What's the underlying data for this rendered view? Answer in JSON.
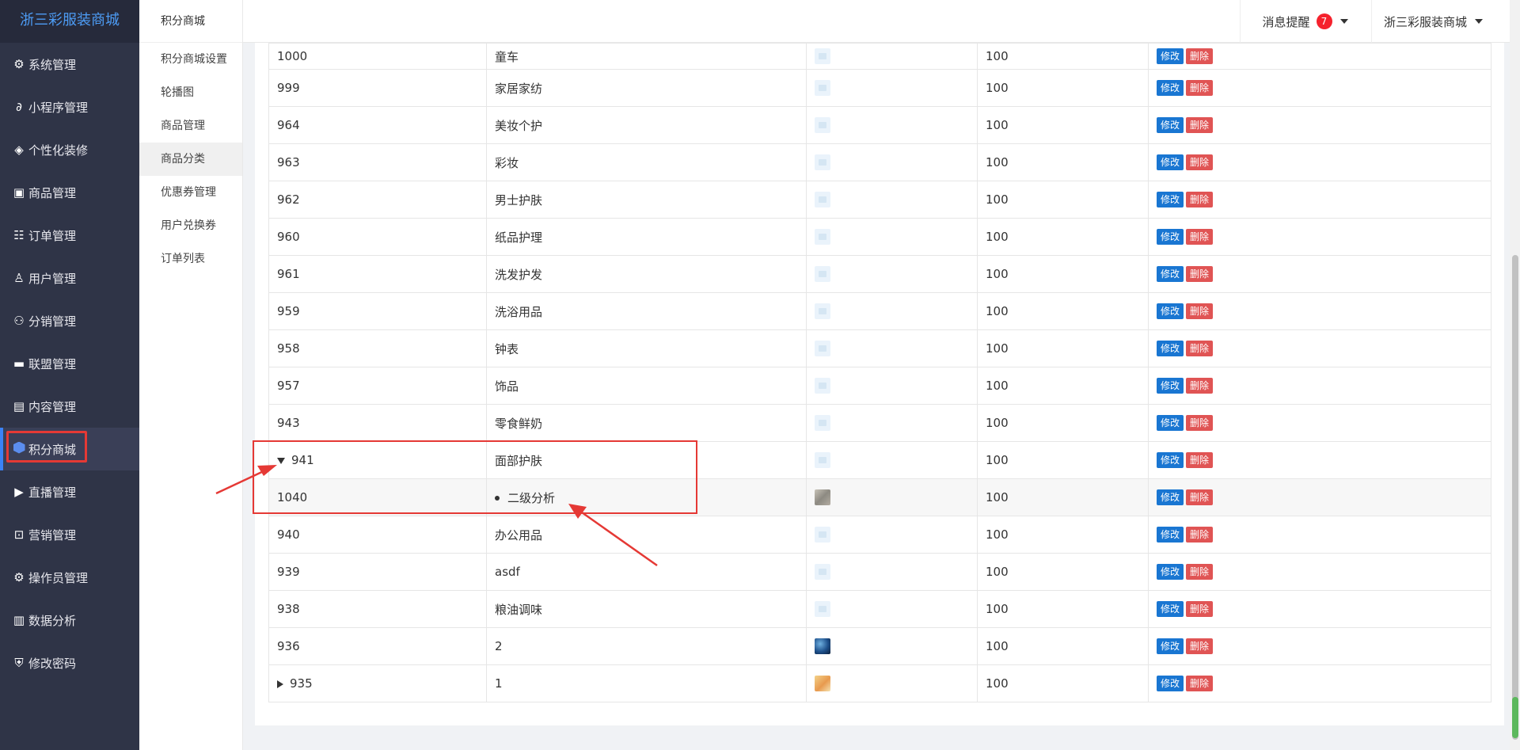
{
  "brand": "浙三彩服装商城",
  "sidebar": {
    "items": [
      {
        "label": "系统管理",
        "icon": "gear-icon",
        "glyph": "⚙"
      },
      {
        "label": "小程序管理",
        "icon": "link-icon",
        "glyph": "🔗"
      },
      {
        "label": "个性化装修",
        "icon": "diamond-icon",
        "glyph": "◈"
      },
      {
        "label": "商品管理",
        "icon": "bag-icon",
        "glyph": "▣"
      },
      {
        "label": "订单管理",
        "icon": "clipboard-icon",
        "glyph": "☷"
      },
      {
        "label": "用户管理",
        "icon": "user-icon",
        "glyph": "♙"
      },
      {
        "label": "分销管理",
        "icon": "network-icon",
        "glyph": "⚇"
      },
      {
        "label": "联盟管理",
        "icon": "store-icon",
        "glyph": "▬"
      },
      {
        "label": "内容管理",
        "icon": "content-icon",
        "glyph": "▤"
      },
      {
        "label": "积分商城",
        "icon": "cube-icon",
        "glyph": ""
      },
      {
        "label": "直播管理",
        "icon": "play-icon",
        "glyph": "▶"
      },
      {
        "label": "营销管理",
        "icon": "marketing-icon",
        "glyph": "⊡"
      },
      {
        "label": "操作员管理",
        "icon": "cog-icon",
        "glyph": "⚙"
      },
      {
        "label": "数据分析",
        "icon": "bar-chart-icon",
        "glyph": "▥"
      },
      {
        "label": "修改密码",
        "icon": "shield-icon",
        "glyph": "⛨"
      }
    ]
  },
  "subnav": {
    "title": "积分商城",
    "items": [
      "积分商城设置",
      "轮播图",
      "商品管理",
      "商品分类",
      "优惠券管理",
      "用户兑换券",
      "订单列表"
    ]
  },
  "header": {
    "messages_label": "消息提醒",
    "messages_count": "7",
    "shop_label": "浙三彩服装商城"
  },
  "table": {
    "edit_label": "修改",
    "delete_label": "删除",
    "rows": [
      {
        "id": "1000",
        "name": "童车",
        "sort": "100"
      },
      {
        "id": "999",
        "name": "家居家纺",
        "sort": "100"
      },
      {
        "id": "964",
        "name": "美妆个护",
        "sort": "100"
      },
      {
        "id": "963",
        "name": "彩妆",
        "sort": "100"
      },
      {
        "id": "962",
        "name": "男士护肤",
        "sort": "100"
      },
      {
        "id": "960",
        "name": "纸品护理",
        "sort": "100"
      },
      {
        "id": "961",
        "name": "洗发护发",
        "sort": "100"
      },
      {
        "id": "959",
        "name": "洗浴用品",
        "sort": "100"
      },
      {
        "id": "958",
        "name": "钟表",
        "sort": "100"
      },
      {
        "id": "957",
        "name": "饰品",
        "sort": "100"
      },
      {
        "id": "943",
        "name": "零食鲜奶",
        "sort": "100"
      },
      {
        "id": "941",
        "name": "面部护肤",
        "sort": "100"
      },
      {
        "id": "1040",
        "name": "二级分析",
        "sort": "100"
      },
      {
        "id": "940",
        "name": "办公用品",
        "sort": "100"
      },
      {
        "id": "939",
        "name": "asdf",
        "sort": "100"
      },
      {
        "id": "938",
        "name": "粮油调味",
        "sort": "100"
      },
      {
        "id": "936",
        "name": "2",
        "sort": "100"
      },
      {
        "id": "935",
        "name": "1",
        "sort": "100"
      }
    ]
  }
}
